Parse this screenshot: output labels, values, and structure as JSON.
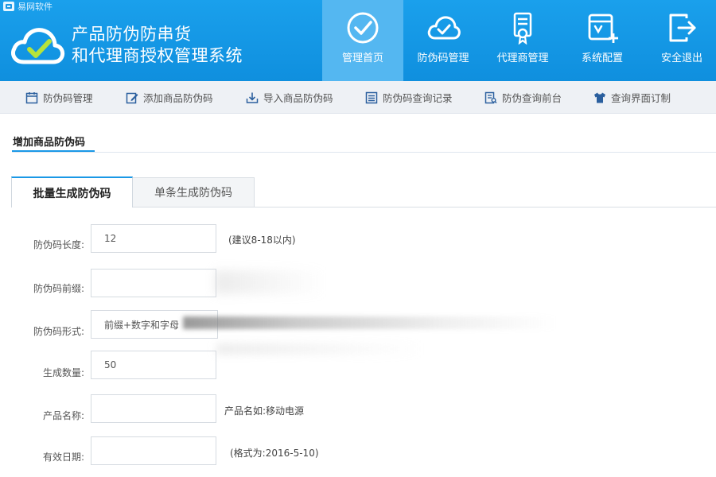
{
  "brand": {
    "name": "易网软件"
  },
  "app": {
    "title_line1": "产品防伪防串货",
    "title_line2": "和代理商授权管理系统"
  },
  "nav": [
    {
      "label": "管理首页",
      "icon": "check-circle-icon",
      "active": true
    },
    {
      "label": "防伪码管理",
      "icon": "cloud-check-icon",
      "active": false
    },
    {
      "label": "代理商管理",
      "icon": "certificate-icon",
      "active": false
    },
    {
      "label": "系统配置",
      "icon": "settings-box-icon",
      "active": false
    },
    {
      "label": "安全退出",
      "icon": "logout-icon",
      "active": false
    }
  ],
  "subnav": [
    {
      "label": "防伪码管理",
      "icon": "calendar-icon"
    },
    {
      "label": "添加商品防伪码",
      "icon": "edit-icon"
    },
    {
      "label": "导入商品防伪码",
      "icon": "import-icon"
    },
    {
      "label": "防伪码查询记录",
      "icon": "list-icon"
    },
    {
      "label": "防伪查询前台",
      "icon": "document-search-icon"
    },
    {
      "label": "查询界面订制",
      "icon": "shirt-icon"
    }
  ],
  "page": {
    "section_title": "增加商品防伪码"
  },
  "tabs": [
    {
      "label": "批量生成防伪码",
      "active": true
    },
    {
      "label": "单条生成防伪码",
      "active": false
    }
  ],
  "form": {
    "code_length": {
      "label": "防伪码长度:",
      "value": "12",
      "hint": "(建议8-18以内)"
    },
    "prefix": {
      "label": "防伪码前缀:",
      "value": ""
    },
    "format": {
      "label": "防伪码形式:",
      "value": "前缀+数字和字母"
    },
    "quantity": {
      "label": "生成数量:",
      "value": "50"
    },
    "product_name": {
      "label": "产品名称:",
      "value": "",
      "hint": "产品名如:移动电源"
    },
    "valid_date": {
      "label": "有效日期:",
      "value": "",
      "hint": "(格式为:2016-5-10)"
    }
  },
  "colors": {
    "header": "#1296e2",
    "nav_active": "#54b7f1",
    "accent": "#1a98e6",
    "subbar": "#eef1f5"
  }
}
